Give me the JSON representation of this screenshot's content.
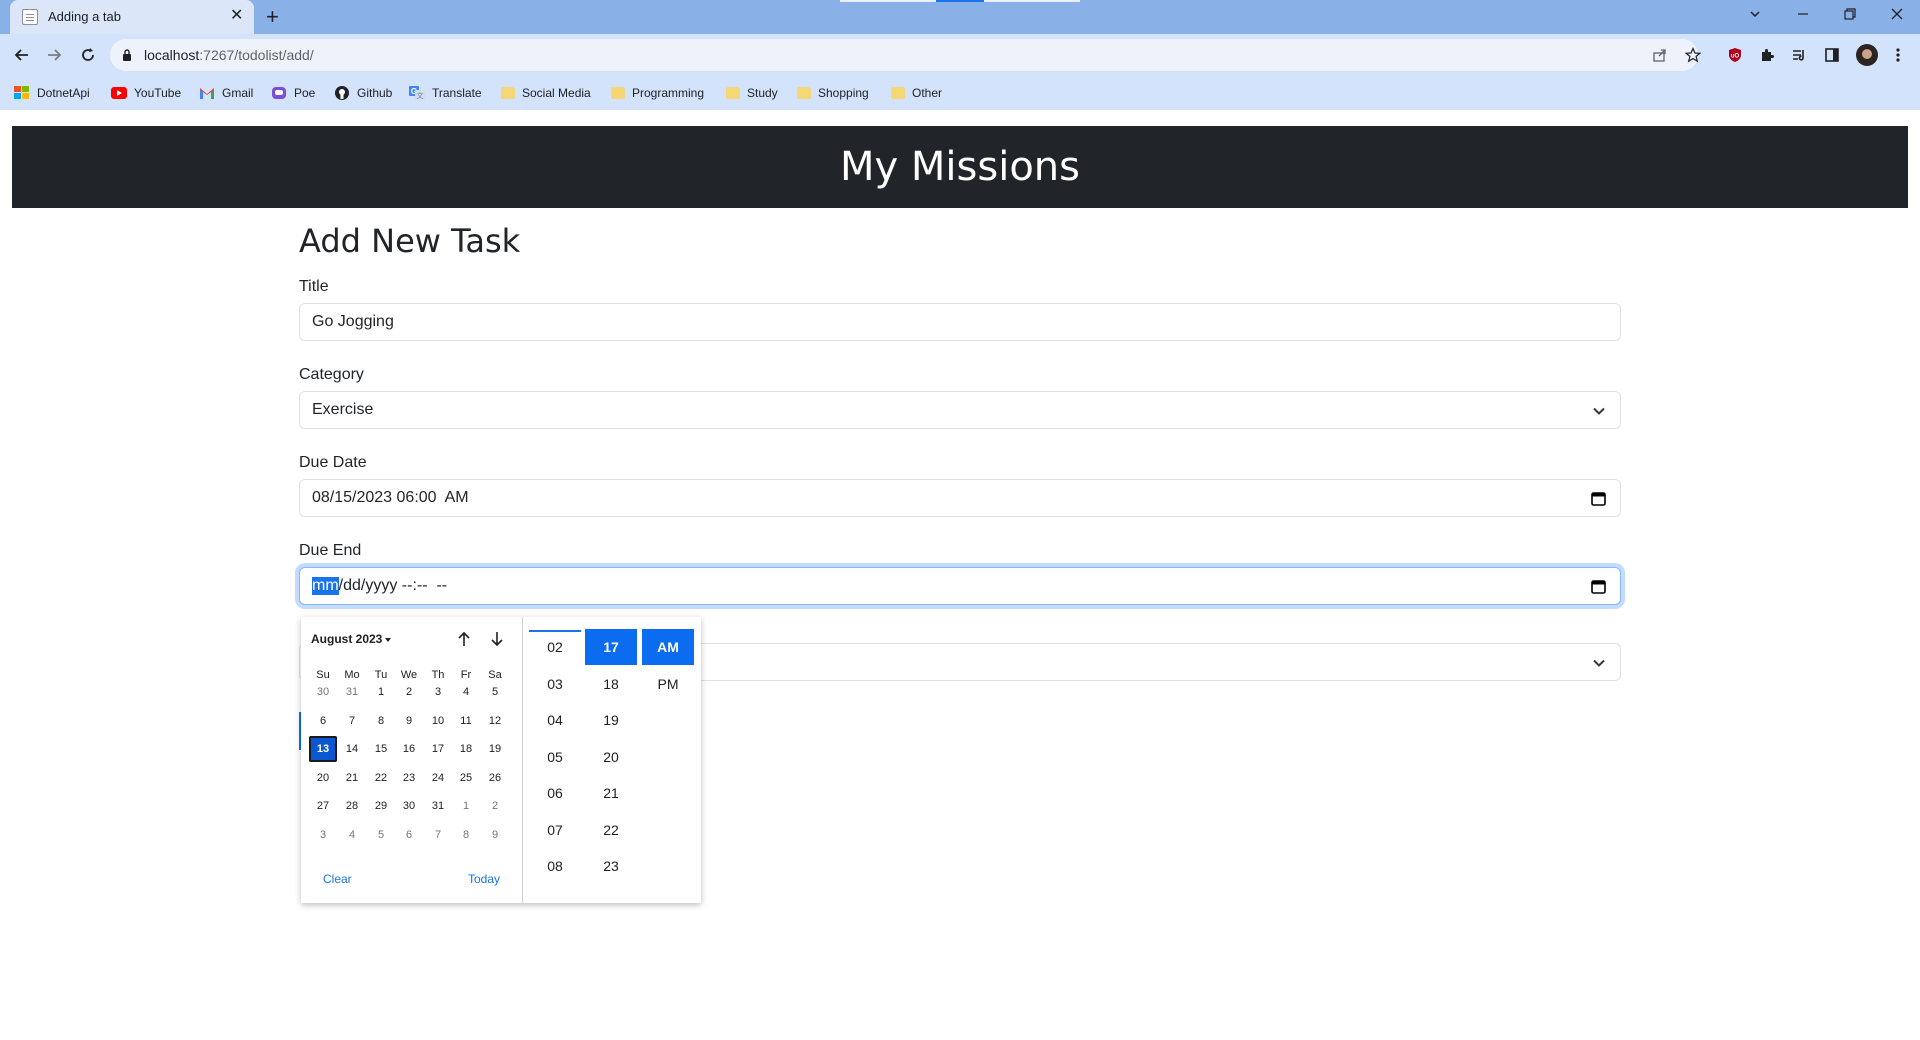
{
  "browser": {
    "tab_title": "Adding a tab",
    "tab_close": "✕",
    "new_tab": "+",
    "url_host": "localhost",
    "url_path": ":7267/todolist/add/",
    "bookmarks": [
      {
        "label": "DotnetApi",
        "icon": "windows-grid-icon"
      },
      {
        "label": "YouTube",
        "icon": "youtube-icon"
      },
      {
        "label": "Gmail",
        "icon": "gmail-icon"
      },
      {
        "label": "Poe",
        "icon": "poe-icon"
      },
      {
        "label": "Github",
        "icon": "github-icon"
      },
      {
        "label": "Translate",
        "icon": "translate-icon"
      },
      {
        "label": "Social Media",
        "icon": "folder-icon"
      },
      {
        "label": "Programming",
        "icon": "folder-icon"
      },
      {
        "label": "Study",
        "icon": "folder-icon"
      },
      {
        "label": "Shopping",
        "icon": "folder-icon"
      },
      {
        "label": "Other",
        "icon": "folder-icon"
      }
    ]
  },
  "page": {
    "header": "My Missions",
    "form_title": "Add New Task",
    "fields": {
      "title_label": "Title",
      "title_value": "Go Jogging",
      "category_label": "Category",
      "category_value": "Exercise",
      "due_date_label": "Due Date",
      "due_date_value": "08/15/2023 06:00  AM",
      "due_end_label": "Due End",
      "due_end_month_seg": "mm",
      "due_end_rest": "/dd/yyyy --:--  --"
    }
  },
  "picker": {
    "month_label": "August 2023",
    "weekdays": [
      "Su",
      "Mo",
      "Tu",
      "We",
      "Th",
      "Fr",
      "Sa"
    ],
    "weeks": [
      [
        "30",
        "31",
        "1",
        "2",
        "3",
        "4",
        "5"
      ],
      [
        "6",
        "7",
        "8",
        "9",
        "10",
        "11",
        "12"
      ],
      [
        "13",
        "14",
        "15",
        "16",
        "17",
        "18",
        "19"
      ],
      [
        "20",
        "21",
        "22",
        "23",
        "24",
        "25",
        "26"
      ],
      [
        "27",
        "28",
        "29",
        "30",
        "31",
        "1",
        "2"
      ],
      [
        "3",
        "4",
        "5",
        "6",
        "7",
        "8",
        "9"
      ]
    ],
    "selected_day": "13",
    "clear_label": "Clear",
    "today_label": "Today",
    "hours": [
      "02",
      "03",
      "04",
      "05",
      "06",
      "07",
      "08"
    ],
    "minutes": [
      "17",
      "18",
      "19",
      "20",
      "21",
      "22",
      "23"
    ],
    "selected_minute": "17",
    "ampm": [
      "AM",
      "PM"
    ],
    "selected_ampm": "AM"
  },
  "colors": {
    "header_bg": "#212529",
    "accent": "#0b6cf0",
    "tabstrip": "#8ab0e8",
    "toolbar": "#d3e3fb"
  }
}
